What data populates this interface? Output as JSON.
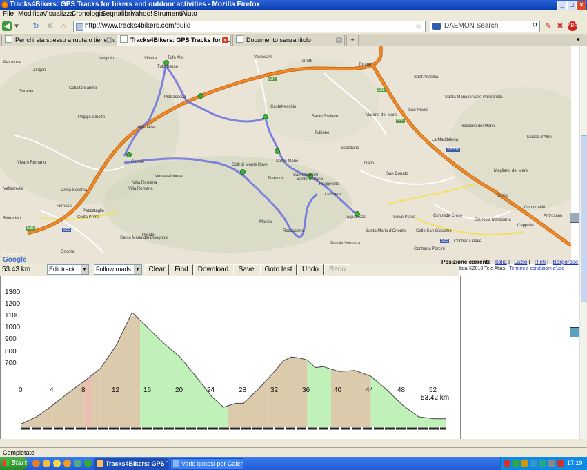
{
  "window": {
    "title": "Tracks4Bikers: GPS Tracks for bikers and outdoor activities - Mozilla Firefox",
    "min": "_",
    "max": "□",
    "close": "×"
  },
  "menu": [
    "File",
    "Modifica",
    "Visualizza",
    "Cronologia",
    "Segnalibri",
    "Yahoo!",
    "Strumenti",
    "Aiuto"
  ],
  "nav": {
    "url": "http://www.tracks4bikers.com/build",
    "search_placeholder": "DAEMON Search"
  },
  "tabs": [
    {
      "label": "Per chi sta spesso a ruota o tiene qualc..."
    },
    {
      "label": "Tracks4Bikers: GPS Tracks for bi..."
    },
    {
      "label": "Documento senza titolo"
    }
  ],
  "map": {
    "labels": [
      "Petraforte",
      "Zingari",
      "Nespolo",
      "Villetta",
      "Tufo Alto",
      "Tufo Basso",
      "Valdevarri",
      "Grotti",
      "Torano",
      "Sant'Anatolia",
      "Turania",
      "Collalto Sabino",
      "Pietrasecca",
      "Castelvecchio",
      "Santo Stefano",
      "Marano dei Marsi",
      "San Nicola",
      "Santa Maria in Valle Porclaneta",
      "Poggio Cinolfo",
      "Rosciolo dei Marsi",
      "Villa Ilaria",
      "Tubione",
      "Scanzano",
      "La Maddalena",
      "Massa d'Albe",
      "Vivaro Romano",
      "Carsoli",
      "Colli di Monte Bove",
      "Sante Marie",
      "Gallo",
      "San Donato",
      "Magliano de' Marsi",
      "Montesabinese",
      "Tremonti",
      "San Giovanni",
      "Poggetello",
      "Villa Romana",
      "Santo Stefano",
      "Vallinfreda",
      "Civita Secchia",
      "Le Crete",
      "Sorbo",
      "Fornace",
      "Civita Prima",
      "Pezzetaglie",
      "Villa Romana",
      "Tagliacozzo",
      "Selve Piane",
      "Corcumello",
      "Antrosano",
      "Pereto",
      "Marsia",
      "Roccacerro",
      "Santa Maria d'Oriente",
      "Colle San Giacomo",
      "Contrada Croce",
      "Scurcola Marsicana",
      "Cappelle",
      "Riofreddo",
      "Oricola",
      "Santa Maria dei Bisognosi",
      "Piccola Svizzera",
      "Contrada Porcini",
      "Contrada Paee"
    ],
    "roads": [
      "E80",
      "A24",
      "A25",
      "SS5",
      "SR578",
      "SS5",
      "E80"
    ],
    "google": "Google",
    "powered": "POWERED BY",
    "position_label": "Posizione corrente",
    "breadcrumbs": [
      "Italia",
      "Lazio",
      "Rieti",
      "Borgorose"
    ],
    "copyright": "data ©2010 Tele Atlas -",
    "terms": "Termini e condizioni d'uso"
  },
  "toolbar": {
    "distance": "53.43 km",
    "edit_select": "Edit track",
    "roads_select": "Follow roads",
    "buttons": [
      "Clear",
      "Find",
      "Download",
      "Save",
      "Goto last",
      "Undo",
      "Redo"
    ]
  },
  "chart_data": {
    "type": "area",
    "title": "",
    "xlabel": "",
    "ylabel": "",
    "distance_label": "53.42 km",
    "y_ticks": [
      "1300",
      "1200",
      "1100",
      "1000",
      "900",
      "800",
      "700"
    ],
    "x_ticks": [
      "0",
      "4",
      "8",
      "12",
      "16",
      "20",
      "24",
      "28",
      "32",
      "36",
      "40",
      "44",
      "48",
      "52"
    ],
    "xlim": [
      0,
      53.42
    ],
    "ylim": [
      600,
      1300
    ],
    "x": [
      0,
      2,
      4,
      6,
      8,
      10,
      12,
      14,
      16,
      18,
      20,
      22,
      24,
      25.5,
      27,
      28,
      30,
      32,
      33,
      34,
      35,
      36,
      37,
      38,
      40,
      42,
      44,
      46,
      48,
      50,
      52,
      53.42
    ],
    "y": [
      612,
      650,
      710,
      775,
      835,
      900,
      1020,
      1190,
      1110,
      1030,
      960,
      860,
      755,
      700,
      720,
      720,
      800,
      890,
      940,
      960,
      955,
      945,
      905,
      910,
      885,
      890,
      860,
      790,
      710,
      650,
      640,
      640
    ],
    "segments": [
      {
        "from": 0,
        "to": 4,
        "grade": "2"
      },
      {
        "from": 4,
        "to": 8,
        "grade": "4"
      },
      {
        "from": 8,
        "to": 9,
        "grade": "7"
      },
      {
        "from": 9,
        "to": 10,
        "grade": "2"
      },
      {
        "from": 10,
        "to": 15,
        "grade": "5"
      },
      {
        "from": 15,
        "to": 19,
        "grade": "-4"
      },
      {
        "from": 19,
        "to": 20,
        "grade": "-8"
      },
      {
        "from": 20,
        "to": 25,
        "grade": "-4"
      },
      {
        "from": 25,
        "to": 26,
        "grade": "-6"
      },
      {
        "from": 26,
        "to": 31,
        "grade": "1"
      },
      {
        "from": 31,
        "to": 36,
        "grade": "4"
      },
      {
        "from": 36,
        "to": 39,
        "grade": "-3"
      },
      {
        "from": 39,
        "to": 44,
        "grade": "-0"
      },
      {
        "from": 44,
        "to": 49,
        "grade": "-5"
      },
      {
        "from": 49,
        "to": 53.42,
        "grade": "-1"
      }
    ]
  },
  "status": {
    "text": "Completato"
  },
  "taskbar": {
    "start": "Start",
    "tasks": [
      "Tracks4Bikers: GPS Tr...",
      "Varie ipotesi  per Calend..."
    ],
    "clock": "17.19"
  },
  "colors": {
    "track": "#6a6fe0",
    "uphill": "#d8c4a4",
    "downhill": "#b8f0b0",
    "elev_line": "#444444",
    "highway": "#f07820",
    "link": "#1b33c9"
  }
}
